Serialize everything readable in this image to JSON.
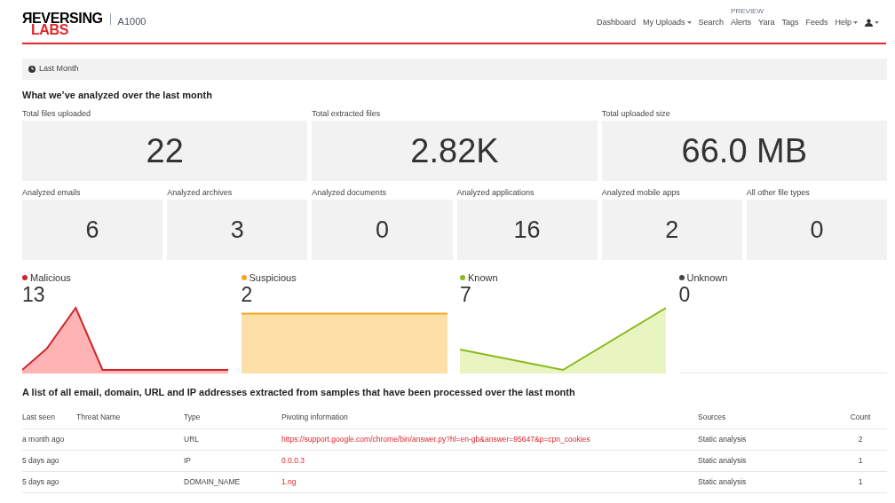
{
  "header": {
    "logo_top": "ЯEVERSING",
    "logo_bottom": "LABS",
    "product": "A1000",
    "nav": [
      {
        "label": "Dashboard",
        "dropdown": false
      },
      {
        "label": "My Uploads",
        "dropdown": true
      },
      {
        "label": "Search",
        "dropdown": false
      },
      {
        "label": "Alerts",
        "dropdown": false,
        "badge": "PREVIEW"
      },
      {
        "label": "Yara",
        "dropdown": false
      },
      {
        "label": "Tags",
        "dropdown": false
      },
      {
        "label": "Feeds",
        "dropdown": false
      },
      {
        "label": "Help",
        "dropdown": true
      }
    ]
  },
  "filter": {
    "label": "Last Month"
  },
  "summary": {
    "title": "What we’ve analyzed over the last month",
    "big": [
      {
        "label": "Total files uploaded",
        "value": "22"
      },
      {
        "label": "Total extracted files",
        "value": "2.82K"
      },
      {
        "label": "Total uploaded size",
        "value": "66.0 MB"
      }
    ],
    "small": [
      {
        "label": "Analyzed emails",
        "value": "6"
      },
      {
        "label": "Analyzed archives",
        "value": "3"
      },
      {
        "label": "Analyzed documents",
        "value": "0"
      },
      {
        "label": "Analyzed applications",
        "value": "16"
      },
      {
        "label": "Analyzed mobile apps",
        "value": "2"
      },
      {
        "label": "All other file types",
        "value": "0"
      }
    ]
  },
  "classification": [
    {
      "label": "Malicious",
      "count": "13",
      "color": "#d0262b",
      "kind": "peak"
    },
    {
      "label": "Suspicious",
      "count": "2",
      "color": "#f5a623",
      "kind": "flat"
    },
    {
      "label": "Known",
      "count": "7",
      "color": "#8cb81e",
      "kind": "valley"
    },
    {
      "label": "Unknown",
      "count": "0",
      "color": "#444444",
      "kind": "none"
    }
  ],
  "table": {
    "title": "A list of all email, domain, URL and IP addresses extracted from samples that have been processed over the last month",
    "columns": [
      "Last seen",
      "Threat Name",
      "Type",
      "Pivoting information",
      "Sources",
      "Count"
    ],
    "rows": [
      {
        "last_seen": "a month ago",
        "type": "URL",
        "pivot": "https://support.google.com/chrome/bin/answer.py?hl=en-gb&answer=95647&p=cpn_cookies",
        "sources": "Static analysis",
        "count": "2"
      },
      {
        "last_seen": "5 days ago",
        "type": "IP",
        "pivot": "0.0.0.3",
        "sources": "Static analysis",
        "count": "1"
      },
      {
        "last_seen": "5 days ago",
        "type": "DOMAIN_NAME",
        "pivot": "1.ng",
        "sources": "Static analysis",
        "count": "1"
      }
    ]
  }
}
